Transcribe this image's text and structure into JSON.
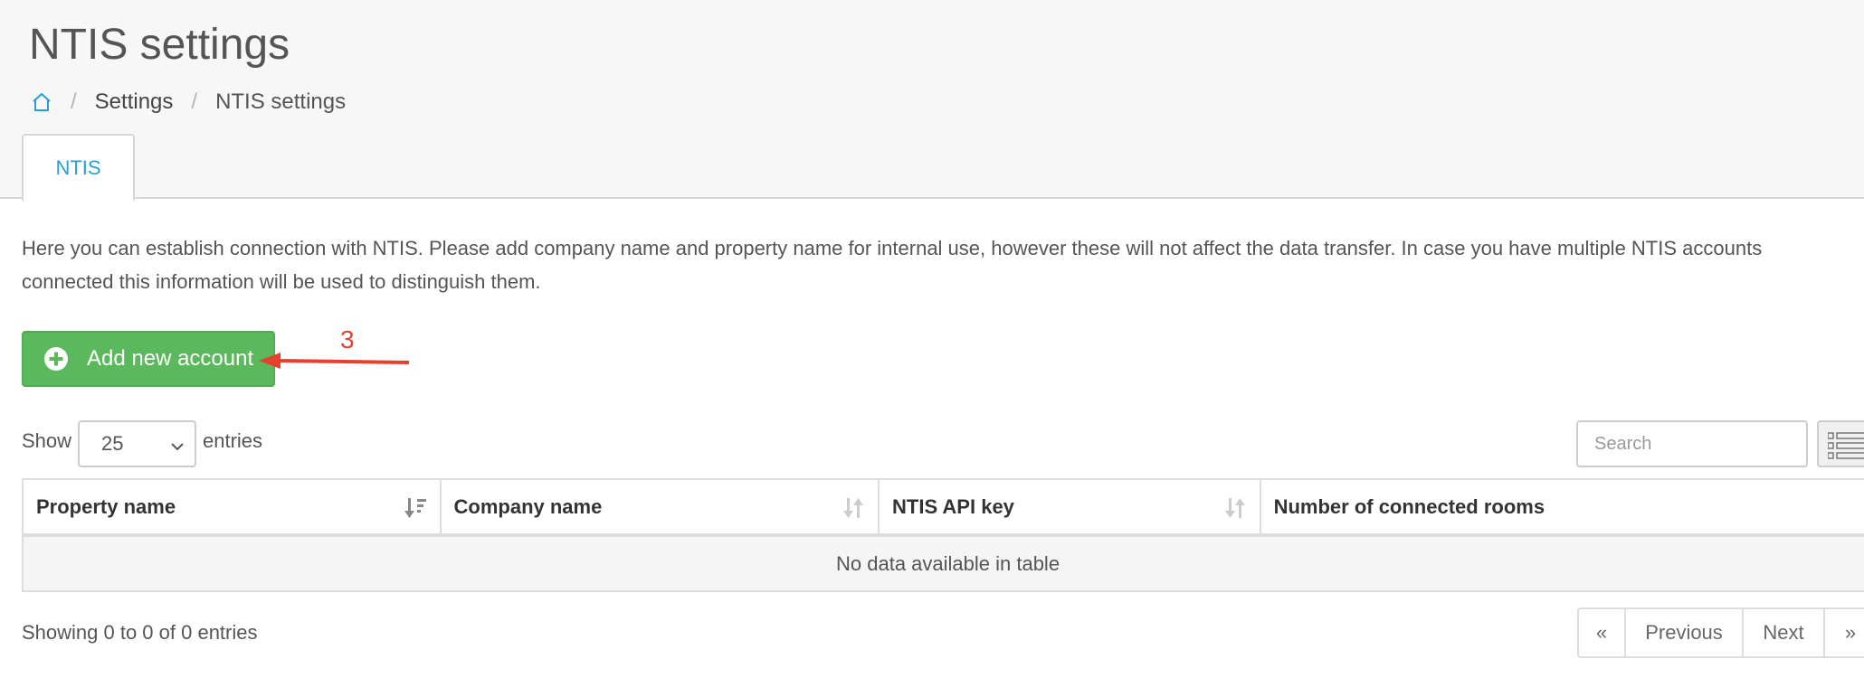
{
  "page": {
    "title": "NTIS settings"
  },
  "breadcrumb": {
    "home_icon": "home-icon",
    "items": [
      "Settings",
      "NTIS settings"
    ]
  },
  "tabs": [
    {
      "label": "NTIS",
      "active": true
    }
  ],
  "description": "Here you can establish connection with NTIS. Please add company name and property name for internal use, however these will not affect the data transfer. In case you have multiple NTIS accounts connected this information will be used to distinguish them.",
  "add_button": {
    "label": "Add new account",
    "icon": "plus-circle-icon"
  },
  "annotation": {
    "number": "3",
    "color": "#e8402f"
  },
  "table_controls": {
    "show_label": "Show",
    "page_length": "25",
    "entries_label": "entries",
    "search_placeholder": "Search",
    "columns_icon": "list-icon"
  },
  "table": {
    "columns": [
      "Property name",
      "Company name",
      "NTIS API key",
      "Number of connected rooms"
    ],
    "empty_message": "No data available in table"
  },
  "footer": {
    "info": "Showing 0 to 0 of 0 entries",
    "pagination": {
      "first": "«",
      "previous": "Previous",
      "next": "Next",
      "last": "»"
    }
  },
  "colors": {
    "accent": "#2a9fd6",
    "success": "#5cb85c",
    "annotation": "#e8402f"
  }
}
